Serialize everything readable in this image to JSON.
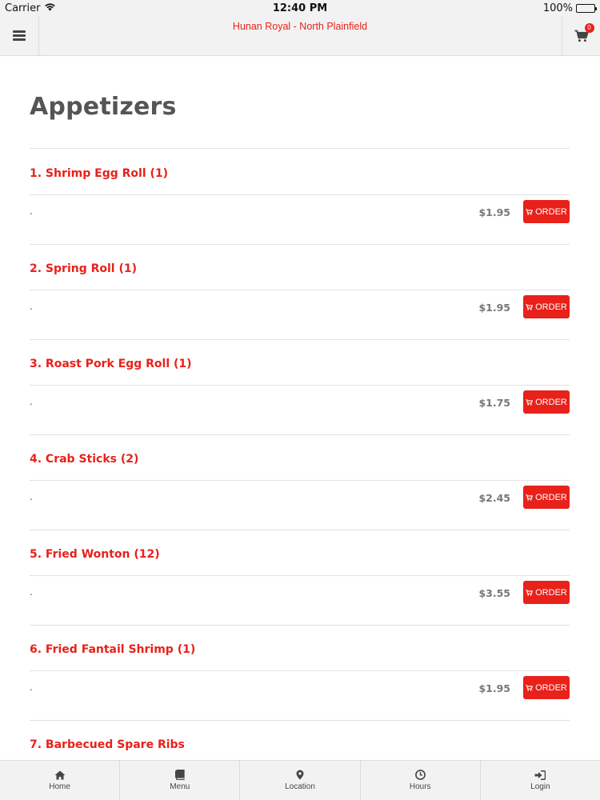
{
  "status_bar": {
    "carrier": "Carrier",
    "time": "12:40 PM",
    "battery": "100%"
  },
  "navbar": {
    "title": "Hunan Royal - North Plainfield",
    "cart_count": "0"
  },
  "section": {
    "title": "Appetizers"
  },
  "order_label": "ORDER",
  "items": [
    {
      "name": "1. Shrimp Egg Roll (1)",
      "description": ".",
      "price": "$1.95"
    },
    {
      "name": "2. Spring Roll (1)",
      "description": ".",
      "price": "$1.95"
    },
    {
      "name": "3. Roast Pork Egg Roll (1)",
      "description": ".",
      "price": "$1.75"
    },
    {
      "name": "4. Crab Sticks (2)",
      "description": ".",
      "price": "$2.45"
    },
    {
      "name": "5. Fried Wonton (12)",
      "description": ".",
      "price": "$3.55"
    },
    {
      "name": "6. Fried Fantail Shrimp (1)",
      "description": ".",
      "price": "$1.95"
    },
    {
      "name": "7. Barbecued Spare Ribs",
      "description": "",
      "price": ""
    }
  ],
  "tabbar": {
    "items": [
      {
        "label": "Home",
        "icon": "home-icon"
      },
      {
        "label": "Menu",
        "icon": "book-icon"
      },
      {
        "label": "Location",
        "icon": "map-pin-icon"
      },
      {
        "label": "Hours",
        "icon": "clock-icon"
      },
      {
        "label": "Login",
        "icon": "login-icon"
      }
    ]
  },
  "colors": {
    "accent": "#e8211a",
    "heading": "#555555",
    "price": "#777777",
    "bar_background": "#f2f2f2"
  }
}
